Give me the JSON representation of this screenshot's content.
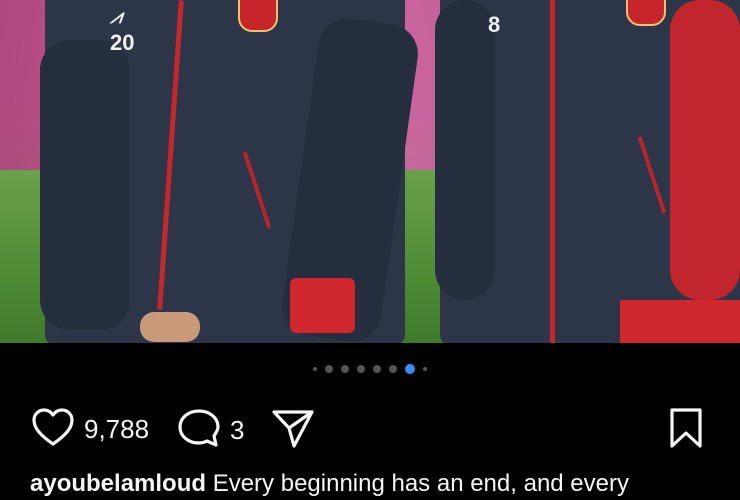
{
  "post": {
    "jersey_numbers": [
      "20",
      "8"
    ],
    "carousel": {
      "total": 8,
      "active_index": 5
    },
    "likes": "9,788",
    "comments": "3",
    "caption": {
      "username": "ayoubelamloud",
      "text": "Every beginning has an end, and every"
    }
  },
  "colors": {
    "background": "#000000",
    "active_dot": "#3d8bff",
    "inactive_dot": "#555555",
    "text": "#f5f5f5"
  },
  "icons": [
    "heart-icon",
    "comment-bubble-icon",
    "share-paper-plane-icon",
    "bookmark-icon"
  ]
}
